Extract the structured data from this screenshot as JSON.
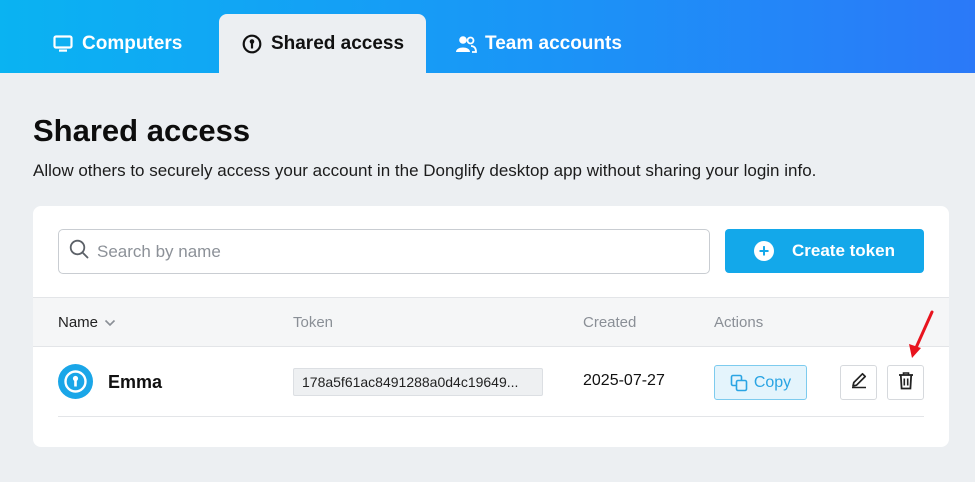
{
  "tabs": [
    {
      "label": "Computers",
      "icon": "monitor-icon",
      "active": false
    },
    {
      "label": "Shared access",
      "icon": "key-icon",
      "active": true
    },
    {
      "label": "Team accounts",
      "icon": "users-icon",
      "active": false
    }
  ],
  "page": {
    "title": "Shared access",
    "description": "Allow others to securely access your account in the Donglify desktop app without sharing your login info."
  },
  "search": {
    "placeholder": "Search by name",
    "value": ""
  },
  "create_button": {
    "label": "Create token"
  },
  "table": {
    "headers": {
      "name": "Name",
      "token": "Token",
      "created": "Created",
      "actions": "Actions"
    },
    "rows": [
      {
        "name": "Emma",
        "token": "178a5f61ac8491288a0d4c19649...",
        "created": "2025-07-27",
        "copy_label": "Copy"
      }
    ]
  },
  "colors": {
    "accent": "#13a8ea",
    "annotation_arrow": "#e8141e"
  }
}
